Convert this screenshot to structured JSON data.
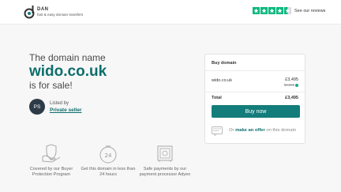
{
  "header": {
    "logo_name": "DAN",
    "logo_tagline": "fast & easy domain transfers",
    "trustpilot_link": "See our reviews"
  },
  "hero": {
    "intro": "The domain name",
    "domain": "wido.co.uk",
    "sale": "is for sale!"
  },
  "seller": {
    "initials": "PS",
    "listed_by": "Listed by",
    "name": "Private seller"
  },
  "card": {
    "title": "Buy domain",
    "domain": "wido.co.uk",
    "price": "£3,495",
    "old_price": "$4,800",
    "total_label": "Total",
    "total_value": "£3,495",
    "buy_button": "Buy now",
    "offer_prefix": "Or ",
    "offer_link": "make an offer",
    "offer_suffix": " on this domain"
  },
  "features": [
    {
      "icon": "buyer-protection-icon",
      "text": "Covered by our Buyer Protection Program"
    },
    {
      "icon": "clock-24-icon",
      "text": "Get this domain in less than 24 hours"
    },
    {
      "icon": "safe-icon",
      "text": "Safe payments by our payment processor Adyen"
    }
  ],
  "colors": {
    "brand": "#0e6e6c",
    "button": "#137d7b",
    "trustpilot": "#00b67a"
  }
}
